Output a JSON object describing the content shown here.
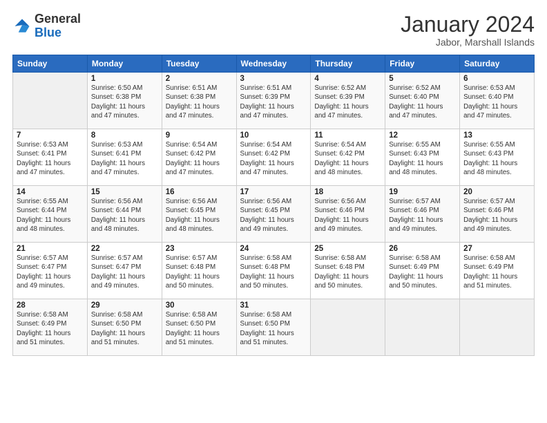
{
  "logo": {
    "general": "General",
    "blue": "Blue"
  },
  "title": {
    "month": "January 2024",
    "location": "Jabor, Marshall Islands"
  },
  "headers": [
    "Sunday",
    "Monday",
    "Tuesday",
    "Wednesday",
    "Thursday",
    "Friday",
    "Saturday"
  ],
  "weeks": [
    [
      {
        "day": "",
        "sunrise": "",
        "sunset": "",
        "daylight": ""
      },
      {
        "day": "1",
        "sunrise": "Sunrise: 6:50 AM",
        "sunset": "Sunset: 6:38 PM",
        "daylight": "Daylight: 11 hours and 47 minutes."
      },
      {
        "day": "2",
        "sunrise": "Sunrise: 6:51 AM",
        "sunset": "Sunset: 6:38 PM",
        "daylight": "Daylight: 11 hours and 47 minutes."
      },
      {
        "day": "3",
        "sunrise": "Sunrise: 6:51 AM",
        "sunset": "Sunset: 6:39 PM",
        "daylight": "Daylight: 11 hours and 47 minutes."
      },
      {
        "day": "4",
        "sunrise": "Sunrise: 6:52 AM",
        "sunset": "Sunset: 6:39 PM",
        "daylight": "Daylight: 11 hours and 47 minutes."
      },
      {
        "day": "5",
        "sunrise": "Sunrise: 6:52 AM",
        "sunset": "Sunset: 6:40 PM",
        "daylight": "Daylight: 11 hours and 47 minutes."
      },
      {
        "day": "6",
        "sunrise": "Sunrise: 6:53 AM",
        "sunset": "Sunset: 6:40 PM",
        "daylight": "Daylight: 11 hours and 47 minutes."
      }
    ],
    [
      {
        "day": "7",
        "sunrise": "Sunrise: 6:53 AM",
        "sunset": "Sunset: 6:41 PM",
        "daylight": "Daylight: 11 hours and 47 minutes."
      },
      {
        "day": "8",
        "sunrise": "Sunrise: 6:53 AM",
        "sunset": "Sunset: 6:41 PM",
        "daylight": "Daylight: 11 hours and 47 minutes."
      },
      {
        "day": "9",
        "sunrise": "Sunrise: 6:54 AM",
        "sunset": "Sunset: 6:42 PM",
        "daylight": "Daylight: 11 hours and 47 minutes."
      },
      {
        "day": "10",
        "sunrise": "Sunrise: 6:54 AM",
        "sunset": "Sunset: 6:42 PM",
        "daylight": "Daylight: 11 hours and 47 minutes."
      },
      {
        "day": "11",
        "sunrise": "Sunrise: 6:54 AM",
        "sunset": "Sunset: 6:42 PM",
        "daylight": "Daylight: 11 hours and 48 minutes."
      },
      {
        "day": "12",
        "sunrise": "Sunrise: 6:55 AM",
        "sunset": "Sunset: 6:43 PM",
        "daylight": "Daylight: 11 hours and 48 minutes."
      },
      {
        "day": "13",
        "sunrise": "Sunrise: 6:55 AM",
        "sunset": "Sunset: 6:43 PM",
        "daylight": "Daylight: 11 hours and 48 minutes."
      }
    ],
    [
      {
        "day": "14",
        "sunrise": "Sunrise: 6:55 AM",
        "sunset": "Sunset: 6:44 PM",
        "daylight": "Daylight: 11 hours and 48 minutes."
      },
      {
        "day": "15",
        "sunrise": "Sunrise: 6:56 AM",
        "sunset": "Sunset: 6:44 PM",
        "daylight": "Daylight: 11 hours and 48 minutes."
      },
      {
        "day": "16",
        "sunrise": "Sunrise: 6:56 AM",
        "sunset": "Sunset: 6:45 PM",
        "daylight": "Daylight: 11 hours and 48 minutes."
      },
      {
        "day": "17",
        "sunrise": "Sunrise: 6:56 AM",
        "sunset": "Sunset: 6:45 PM",
        "daylight": "Daylight: 11 hours and 49 minutes."
      },
      {
        "day": "18",
        "sunrise": "Sunrise: 6:56 AM",
        "sunset": "Sunset: 6:46 PM",
        "daylight": "Daylight: 11 hours and 49 minutes."
      },
      {
        "day": "19",
        "sunrise": "Sunrise: 6:57 AM",
        "sunset": "Sunset: 6:46 PM",
        "daylight": "Daylight: 11 hours and 49 minutes."
      },
      {
        "day": "20",
        "sunrise": "Sunrise: 6:57 AM",
        "sunset": "Sunset: 6:46 PM",
        "daylight": "Daylight: 11 hours and 49 minutes."
      }
    ],
    [
      {
        "day": "21",
        "sunrise": "Sunrise: 6:57 AM",
        "sunset": "Sunset: 6:47 PM",
        "daylight": "Daylight: 11 hours and 49 minutes."
      },
      {
        "day": "22",
        "sunrise": "Sunrise: 6:57 AM",
        "sunset": "Sunset: 6:47 PM",
        "daylight": "Daylight: 11 hours and 49 minutes."
      },
      {
        "day": "23",
        "sunrise": "Sunrise: 6:57 AM",
        "sunset": "Sunset: 6:48 PM",
        "daylight": "Daylight: 11 hours and 50 minutes."
      },
      {
        "day": "24",
        "sunrise": "Sunrise: 6:58 AM",
        "sunset": "Sunset: 6:48 PM",
        "daylight": "Daylight: 11 hours and 50 minutes."
      },
      {
        "day": "25",
        "sunrise": "Sunrise: 6:58 AM",
        "sunset": "Sunset: 6:48 PM",
        "daylight": "Daylight: 11 hours and 50 minutes."
      },
      {
        "day": "26",
        "sunrise": "Sunrise: 6:58 AM",
        "sunset": "Sunset: 6:49 PM",
        "daylight": "Daylight: 11 hours and 50 minutes."
      },
      {
        "day": "27",
        "sunrise": "Sunrise: 6:58 AM",
        "sunset": "Sunset: 6:49 PM",
        "daylight": "Daylight: 11 hours and 51 minutes."
      }
    ],
    [
      {
        "day": "28",
        "sunrise": "Sunrise: 6:58 AM",
        "sunset": "Sunset: 6:49 PM",
        "daylight": "Daylight: 11 hours and 51 minutes."
      },
      {
        "day": "29",
        "sunrise": "Sunrise: 6:58 AM",
        "sunset": "Sunset: 6:50 PM",
        "daylight": "Daylight: 11 hours and 51 minutes."
      },
      {
        "day": "30",
        "sunrise": "Sunrise: 6:58 AM",
        "sunset": "Sunset: 6:50 PM",
        "daylight": "Daylight: 11 hours and 51 minutes."
      },
      {
        "day": "31",
        "sunrise": "Sunrise: 6:58 AM",
        "sunset": "Sunset: 6:50 PM",
        "daylight": "Daylight: 11 hours and 51 minutes."
      },
      {
        "day": "",
        "sunrise": "",
        "sunset": "",
        "daylight": ""
      },
      {
        "day": "",
        "sunrise": "",
        "sunset": "",
        "daylight": ""
      },
      {
        "day": "",
        "sunrise": "",
        "sunset": "",
        "daylight": ""
      }
    ]
  ]
}
